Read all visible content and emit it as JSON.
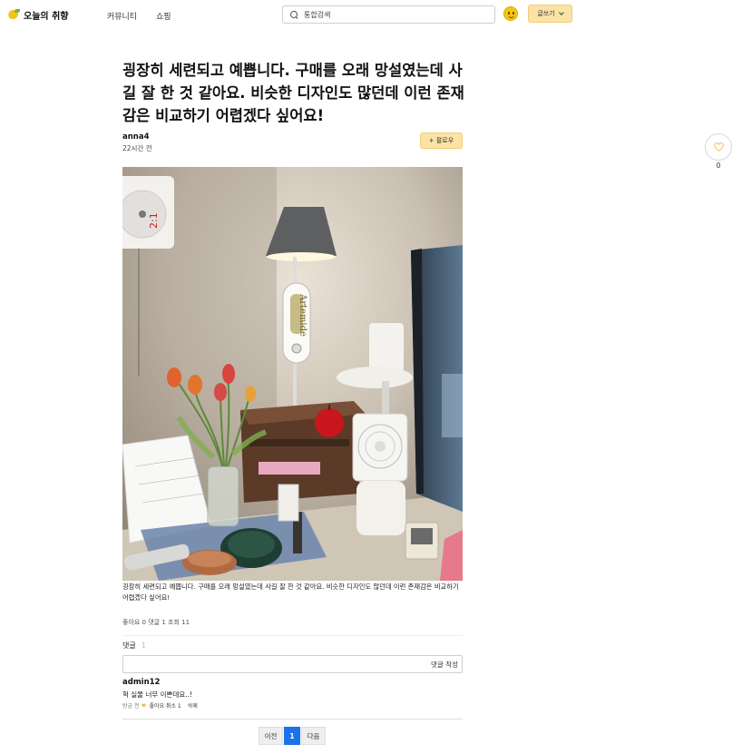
{
  "header": {
    "logo_text": "오늘의 취향",
    "nav": [
      "커뮤니티",
      "쇼핑"
    ],
    "search_placeholder": "통합검색",
    "write_label": "글쓰기"
  },
  "post": {
    "title": "굉장히 세련되고 예쁩니다. 구매를 오래 망설였는데 사길 잘 한 것 같아요. 비슷한 디자인도 많던데 이런 존재감은 비교하기 어렵겠다 싶어요!",
    "author": "anna4",
    "time": "22시간 전",
    "follow_label": "+ 팔로우",
    "body": "굉장히 세련되고 예쁩니다. 구매를 오래 망설였는데 사길 잘 한 것 같아요. 비슷한 디자인도 많던데 이런 존재감은 비교하기 어렵겠다 싶어요!",
    "stats": "좋아요 0 댓글 1 조회 11",
    "like_count": "0",
    "lamp_text": "Artemide"
  },
  "comments": {
    "title": "댓글",
    "count": "1",
    "submit_label": "댓글 작성",
    "items": [
      {
        "author": "admin12",
        "text": "헉 실물 너무 이쁜데요..!",
        "time": "방금 전",
        "like": "좋아요 취소 1",
        "delete": "삭제"
      }
    ]
  },
  "pagination": {
    "prev": "이전",
    "current": "1",
    "next": "다음"
  },
  "colors": {
    "accent_yellow": "#fbe3a6",
    "pager_active": "#1a73e8",
    "comment_count": "#f1b941"
  }
}
